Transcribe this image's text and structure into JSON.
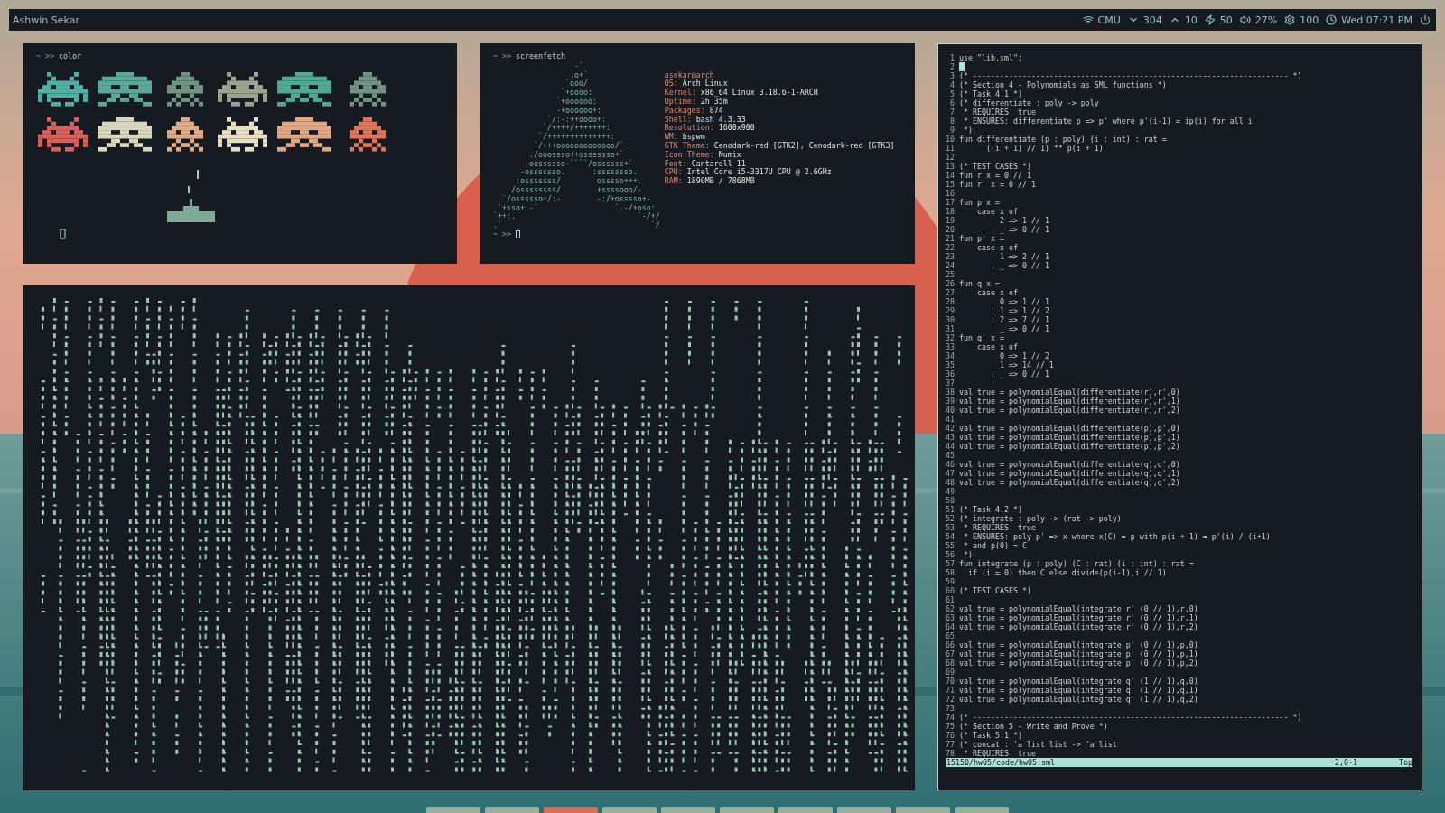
{
  "top_bar": {
    "user": "Ashwin Sekar",
    "network": "CMU",
    "download": "304",
    "upload": "10",
    "battery": "50",
    "volume": "27%",
    "brightness": "100",
    "clock": "Wed 07:21 PM"
  },
  "color_terminal": {
    "prompt": "~ >>",
    "command": "color"
  },
  "screenfetch_terminal": {
    "prompt": "~ >>",
    "command": "screenfetch",
    "logo_lines": [
      "                  -`",
      "                 .o+`",
      "                `ooo/",
      "               `+oooo:",
      "              `+oooooo:",
      "              -+oooooo+:",
      "            `/:-:++oooo+:",
      "           `/++++/+++++++:",
      "          `/++++++++++++++:",
      "         `/+++ooooooooooooo/`",
      "        ./ooossso++osssssso+`",
      "       .oossssso-````/ossssss+`",
      "      -osssssso.      :ssssssso.",
      "     :osssssss/        osssso+++.",
      "    /ossssssss/        +ssssooo/-",
      "  `/ossssso+/:-        -:/+osssso+-",
      " `+sso+:-`                 `.-/+oso:",
      "`++:.                           `-/+/",
      ".`                                 `/"
    ],
    "user_host": "asekar@arch",
    "info": [
      {
        "label": "OS:",
        "value": "Arch Linux"
      },
      {
        "label": "Kernel:",
        "value": "x86_64 Linux 3.18.6-1-ARCH"
      },
      {
        "label": "Uptime:",
        "value": "2h 35m"
      },
      {
        "label": "Packages:",
        "value": "874"
      },
      {
        "label": "Shell:",
        "value": "bash 4.3.33"
      },
      {
        "label": "Resolution:",
        "value": "1600x900"
      },
      {
        "label": "WM:",
        "value": "bspwm"
      },
      {
        "label": "GTK Theme:",
        "value": "Cenodark-red [GTK2], Cenodark-red [GTK3]"
      },
      {
        "label": "Icon Theme:",
        "value": "Numix"
      },
      {
        "label": "Font:",
        "value": "Cantarell 11"
      },
      {
        "label": "CPU:",
        "value": "Intel Core i5-3317U CPU @ 2.6GHz"
      },
      {
        "label": "RAM:",
        "value": "1890MB / 7868MB"
      }
    ],
    "final_prompt": "~ >>"
  },
  "editor": {
    "lines": [
      {
        "n": "1",
        "text": "use \"lib.sml\";",
        "cursor": false
      },
      {
        "n": "2",
        "cursor": true
      },
      {
        "n": "3",
        "text": "(* ---------------------------------------------------------------------- *)",
        "cursor": false
      },
      {
        "n": "4",
        "text": "(* Section 4 - Polynomials as SML functions *)",
        "cursor": false
      },
      {
        "n": "5",
        "text": "(* Task 4.1 *)",
        "cursor": false
      },
      {
        "n": "6",
        "text": "(* differentiate : poly -> poly",
        "cursor": false
      },
      {
        "n": "7",
        "text": " * REQUIRES: true",
        "cursor": false
      },
      {
        "n": "8",
        "text": " * ENSURES: differentiate p => p' where p'(i-1) = ip(i) for all i",
        "cursor": false
      },
      {
        "n": "9",
        "text": " *)",
        "cursor": false
      },
      {
        "n": "10",
        "text": "fun differentiate (p : poly) (i : int) : rat =",
        "cursor": false
      },
      {
        "n": "11",
        "text": "      ((i + 1) // 1) ** p(i + 1)",
        "cursor": false
      },
      {
        "n": "12",
        "cursor": false
      },
      {
        "n": "13",
        "text": "(* TEST CASES *)",
        "cursor": false
      },
      {
        "n": "14",
        "text": "fun r x = 0 // 1",
        "cursor": false
      },
      {
        "n": "15",
        "text": "fun r' x = 0 // 1",
        "cursor": false
      },
      {
        "n": "16",
        "cursor": false
      },
      {
        "n": "17",
        "text": "fun p x =",
        "cursor": false
      },
      {
        "n": "18",
        "text": "    case x of",
        "cursor": false
      },
      {
        "n": "19",
        "text": "         2 => 1 // 1",
        "cursor": false
      },
      {
        "n": "20",
        "text": "       | _ => 0 // 1",
        "cursor": false
      },
      {
        "n": "21",
        "text": "fun p' x =",
        "cursor": false
      },
      {
        "n": "22",
        "text": "    case x of",
        "cursor": false
      },
      {
        "n": "23",
        "text": "         1 => 2 // 1",
        "cursor": false
      },
      {
        "n": "24",
        "text": "       | _ => 0 // 1",
        "cursor": false
      },
      {
        "n": "25",
        "cursor": false
      },
      {
        "n": "26",
        "text": "fun q x =",
        "cursor": false
      },
      {
        "n": "27",
        "text": "    case x of",
        "cursor": false
      },
      {
        "n": "28",
        "text": "         0 => 1 // 1",
        "cursor": false
      },
      {
        "n": "29",
        "text": "       | 1 => 1 // 2",
        "cursor": false
      },
      {
        "n": "30",
        "text": "       | 2 => 7 // 1",
        "cursor": false
      },
      {
        "n": "31",
        "text": "       | _ => 0 // 1",
        "cursor": false
      },
      {
        "n": "32",
        "text": "fun q' x =",
        "cursor": false
      },
      {
        "n": "33",
        "text": "    case x of",
        "cursor": false
      },
      {
        "n": "34",
        "text": "         0 => 1 // 2",
        "cursor": false
      },
      {
        "n": "35",
        "text": "       | 1 => 14 // 1",
        "cursor": false
      },
      {
        "n": "36",
        "text": "       | _ => 0 // 1",
        "cursor": false
      },
      {
        "n": "37",
        "cursor": false
      },
      {
        "n": "38",
        "text": "val true = polynomialEqual(differentiate(r),r',0)",
        "cursor": false
      },
      {
        "n": "39",
        "text": "val true = polynomialEqual(differentiate(r),r',1)",
        "cursor": false
      },
      {
        "n": "40",
        "text": "val true = polynomialEqual(differentiate(r),r',2)",
        "cursor": false
      },
      {
        "n": "41",
        "cursor": false
      },
      {
        "n": "42",
        "text": "val true = polynomialEqual(differentiate(p),p',0)",
        "cursor": false
      },
      {
        "n": "43",
        "text": "val true = polynomialEqual(differentiate(p),p',1)",
        "cursor": false
      },
      {
        "n": "44",
        "text": "val true = polynomialEqual(differentiate(p),p',2)",
        "cursor": false
      },
      {
        "n": "45",
        "cursor": false
      },
      {
        "n": "46",
        "text": "val true = polynomialEqual(differentiate(q),q',0)",
        "cursor": false
      },
      {
        "n": "47",
        "text": "val true = polynomialEqual(differentiate(q),q',1)",
        "cursor": false
      },
      {
        "n": "48",
        "text": "val true = polynomialEqual(differentiate(q),q',2)",
        "cursor": false
      },
      {
        "n": "49",
        "cursor": false
      },
      {
        "n": "50",
        "cursor": false
      },
      {
        "n": "51",
        "text": "(* Task 4.2 *)",
        "cursor": false
      },
      {
        "n": "52",
        "text": "(* integrate : poly -> (rat -> poly)",
        "cursor": false
      },
      {
        "n": "53",
        "text": " * REQUIRES: true",
        "cursor": false
      },
      {
        "n": "54",
        "text": " * ENSURES: poly p' => x where x(C) = p with p(i + 1) = p'(i) / (i+1)",
        "cursor": false
      },
      {
        "n": "55",
        "text": " * and p(0) = C",
        "cursor": false
      },
      {
        "n": "56",
        "text": " *)",
        "cursor": false
      },
      {
        "n": "57",
        "text": "fun integrate (p : poly) (C : rat) (i : int) : rat =",
        "cursor": false
      },
      {
        "n": "58",
        "text": "  if (i = 0) then C else divide(p(i-1),i // 1)",
        "cursor": false
      },
      {
        "n": "59",
        "cursor": false
      },
      {
        "n": "60",
        "text": "(* TEST CASES *)",
        "cursor": false
      },
      {
        "n": "61",
        "cursor": false
      },
      {
        "n": "62",
        "text": "val true = polynomialEqual(integrate r' (0 // 1),r,0)",
        "cursor": false
      },
      {
        "n": "63",
        "text": "val true = polynomialEqual(integrate r' (0 // 1),r,1)",
        "cursor": false
      },
      {
        "n": "64",
        "text": "val true = polynomialEqual(integrate r' (0 // 1),r,2)",
        "cursor": false
      },
      {
        "n": "65",
        "cursor": false
      },
      {
        "n": "66",
        "text": "val true = polynomialEqual(integrate p' (0 // 1),p,0)",
        "cursor": false
      },
      {
        "n": "67",
        "text": "val true = polynomialEqual(integrate p' (0 // 1),p,1)",
        "cursor": false
      },
      {
        "n": "68",
        "text": "val true = polynomialEqual(integrate p' (0 // 1),p,2)",
        "cursor": false
      },
      {
        "n": "69",
        "cursor": false
      },
      {
        "n": "70",
        "text": "val true = polynomialEqual(integrate q' (1 // 1),q,0)",
        "cursor": false
      },
      {
        "n": "71",
        "text": "val true = polynomialEqual(integrate q' (1 // 1),q,1)",
        "cursor": false
      },
      {
        "n": "72",
        "text": "val true = polynomialEqual(integrate q' (1 // 1),q,2)",
        "cursor": false
      },
      {
        "n": "73",
        "cursor": false
      },
      {
        "n": "74",
        "text": "(* ---------------------------------------------------------------------- *)",
        "cursor": false
      },
      {
        "n": "75",
        "text": "(* Section 5 - Write and Prove *)",
        "cursor": false
      },
      {
        "n": "76",
        "text": "(* Task 5.1 *)",
        "cursor": false
      },
      {
        "n": "77",
        "text": "(* concat : 'a list list -> 'a list",
        "cursor": false
      },
      {
        "n": "78",
        "text": " * REQUIRES: true",
        "cursor": false
      }
    ],
    "status_bar": {
      "path": "15150/hw05/code/hw05.sml",
      "position": "2,0-1",
      "scroll": "Top"
    }
  },
  "workspaces": [
    {
      "selected": false
    },
    {
      "selected": false
    },
    {
      "selected": true
    },
    {
      "selected": false
    },
    {
      "selected": false
    },
    {
      "selected": false
    },
    {
      "selected": false
    },
    {
      "selected": false
    },
    {
      "selected": false
    },
    {
      "selected": false
    }
  ]
}
